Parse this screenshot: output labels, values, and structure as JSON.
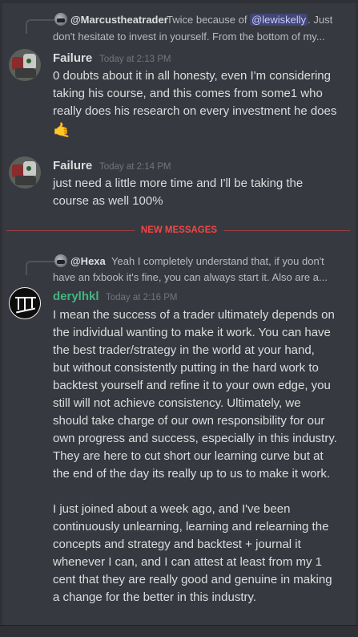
{
  "messages": [
    {
      "reply": {
        "author": "@Marcustheatrader",
        "text_before_mention": "Twice because of ",
        "mention": "@lewiskelly",
        "text_after_mention": ". Just",
        "line2": "don't hesitate to invest in yourself. From the bottom of my..."
      },
      "author": "Failure",
      "author_color": "#ffffff",
      "timestamp": "Today at 2:13 PM",
      "lines": [
        "0 doubts about it in all honesty, even I'm considering",
        "taking his course, and this comes from some1 who",
        "really does his research on every investment he does"
      ],
      "emoji": "🤙"
    },
    {
      "author": "Failure",
      "author_color": "#ffffff",
      "timestamp": "Today at 2:14 PM",
      "lines": [
        "just need a little more time and I'll be taking the",
        "course as well 100%"
      ]
    },
    {
      "reply": {
        "author": "@Hexa",
        "text": "Yeah I completely understand that, if you don't",
        "line2": "have an fxbook it's fine, you can always start it. Also are a..."
      },
      "author": "derylhkl",
      "author_color": "#43b581",
      "timestamp": "Today at 2:16 PM",
      "lines": [
        "I mean the success of a trader ultimately depends on",
        "the individual wanting to make it work. You can have",
        "the best trader/strategy in the world at your hand,",
        "but without consistently putting in the hard work to",
        "backtest yourself and refine it to your own edge, you",
        "still will not achieve consistency. Ultimately, we",
        "should take charge of our own responsibility for our",
        "own progress and success, especially in this industry.",
        "They are here to cut short our learning curve but at",
        "the end of the day its really up to us to make it work.",
        "",
        "I just joined about a week ago, and I've been",
        "continuously unlearning, learning and relearning the",
        "concepts and strategy and backtest + journal it",
        "whenever I can, and I can attest at least from my 1",
        "cent that they are really good and genuine in making",
        "a change for the better in this industry."
      ]
    }
  ],
  "divider_label": "NEW MESSAGES",
  "colors": {
    "background": "#36393f",
    "text": "#dcddde",
    "muted": "#72767d",
    "new_messages": "#f04747",
    "mention_bg": "#414675",
    "online_green": "#43b581"
  }
}
